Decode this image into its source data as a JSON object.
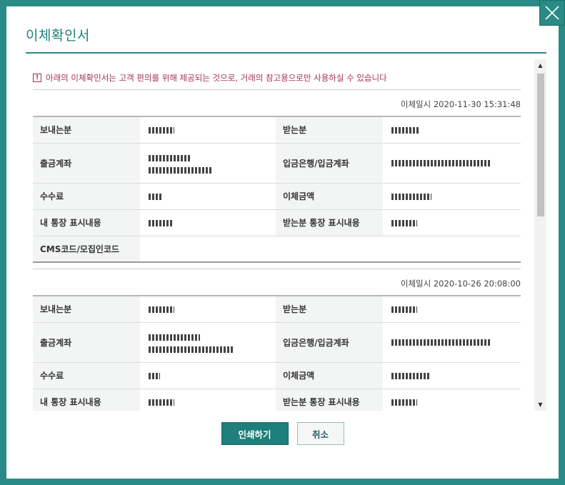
{
  "modal": {
    "title": "이체확인서",
    "notice": "아래의 이체확인서는 고객 편의를 위해 제공되는 것으로, 거래의 참고용으로만 사용하실 수 있습니다",
    "icons": {
      "close": "close-icon",
      "notice": "exclamation-icon",
      "scroll_up": "triangle-up-icon",
      "scroll_down": "triangle-down-icon"
    }
  },
  "labels": {
    "sender": "보내는분",
    "receiver": "받는분",
    "withdraw_account": "출금계좌",
    "deposit_bank_account": "입금은행/입금계좌",
    "fee": "수수료",
    "amount": "이체금액",
    "my_memo": "내 통장 표시내용",
    "receiver_memo": "받는분 통장 표시내용",
    "cms_code": "CMS코드/모집인코드"
  },
  "records": [
    {
      "datetime": "이체일시 2020-11-30 15:31:48"
    },
    {
      "datetime": "이체일시 2020-10-26 20:08:00"
    }
  ],
  "buttons": {
    "print": "인쇄하기",
    "cancel": "취소"
  },
  "colors": {
    "accent": "#2a8a86",
    "notice": "#a0305a"
  }
}
